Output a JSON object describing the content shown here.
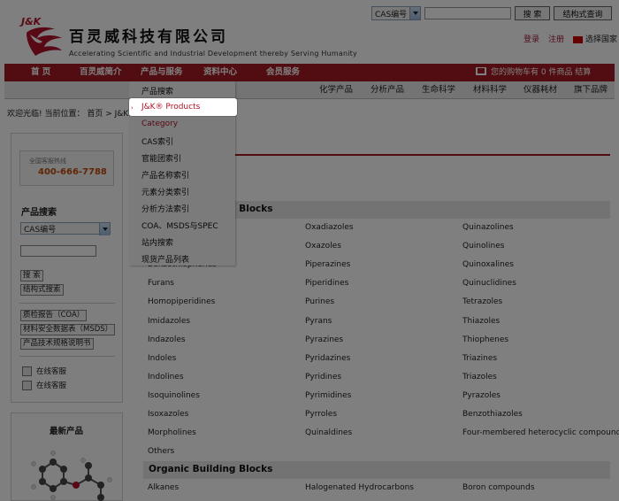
{
  "header": {
    "logo_text": "J&K",
    "title": "百灵威科技有限公司",
    "tagline": "Accelerating Scientific and Industrial Development thereby Serving Humanity",
    "search": {
      "select_value": "CAS编号",
      "input_value": "",
      "search_button": "搜 索",
      "structure_button": "结构式查询"
    },
    "links": {
      "login": "登录",
      "register": "注册",
      "country": "选择国家"
    }
  },
  "nav": {
    "items": [
      "首 页",
      "百灵威简介",
      "产品与服务",
      "资料中心",
      "会员服务"
    ],
    "cart": "您的购物车有 0 件商品  结算"
  },
  "subnav": {
    "items": [
      "化学产品",
      "分析产品",
      "生命科学",
      "材料科学",
      "仪器耗材",
      "旗下品牌"
    ]
  },
  "breadcrumb": "欢迎光临! 当前位置：  首页  > J&K®",
  "dropdown": {
    "items": [
      "产品搜索",
      "J&K® Products",
      "Category",
      "CAS索引",
      "官能团索引",
      "产品名称索引",
      "元素分类索引",
      "分析方法索引",
      "COA、MSDS与SPEC",
      "站内搜索",
      "现货产品列表"
    ],
    "active_index": 1
  },
  "sidebar": {
    "hotline_label": "全国客服热线",
    "hotline_number": "400-666-7788",
    "search_title": "产品搜索",
    "search_select": "CAS编号",
    "search_input": "",
    "search_button": "搜 索",
    "structure_button": "结构式搜索",
    "doc_links": [
      "质检报告（COA）",
      "材料安全数据表（MSDS）",
      "产品技术规格说明书"
    ],
    "online_service": [
      "在线客服",
      "在线客服"
    ],
    "new_products_title": "最新产品"
  },
  "main": {
    "sections": [
      {
        "title": "Heterocyclic Building Blocks",
        "visible_title": "ing Blocks",
        "rows": [
          [
            "",
            "Oxadiazoles",
            "Quinazolines"
          ],
          [
            "",
            "Oxazoles",
            "Quinolines"
          ],
          [
            "Benzothiophenes",
            "Piperazines",
            "Quinoxalines"
          ],
          [
            "Furans",
            "Piperidines",
            "Quinuclidines"
          ],
          [
            "Homopiperidines",
            "Purines",
            "Tetrazoles"
          ],
          [
            "Imidazoles",
            "Pyrans",
            "Thiazoles"
          ],
          [
            "Indazoles",
            "Pyrazines",
            "Thiophenes"
          ],
          [
            "Indoles",
            "Pyridazines",
            "Triazines"
          ],
          [
            "Indolines",
            "Pyridines",
            "Triazoles"
          ],
          [
            "Isoquinolines",
            "Pyrimidines",
            "Pyrazoles"
          ],
          [
            "Isoxazoles",
            "Pyrroles",
            "Benzothiazoles"
          ],
          [
            "Morpholines",
            "Quinaldines",
            "Four-membered heterocyclic compound"
          ],
          [
            "Others",
            "",
            ""
          ]
        ]
      },
      {
        "title": "Organic Building Blocks",
        "rows": [
          [
            "Alkanes",
            "Halogenated Hydrocarbons",
            "Boron compounds"
          ]
        ]
      }
    ]
  }
}
